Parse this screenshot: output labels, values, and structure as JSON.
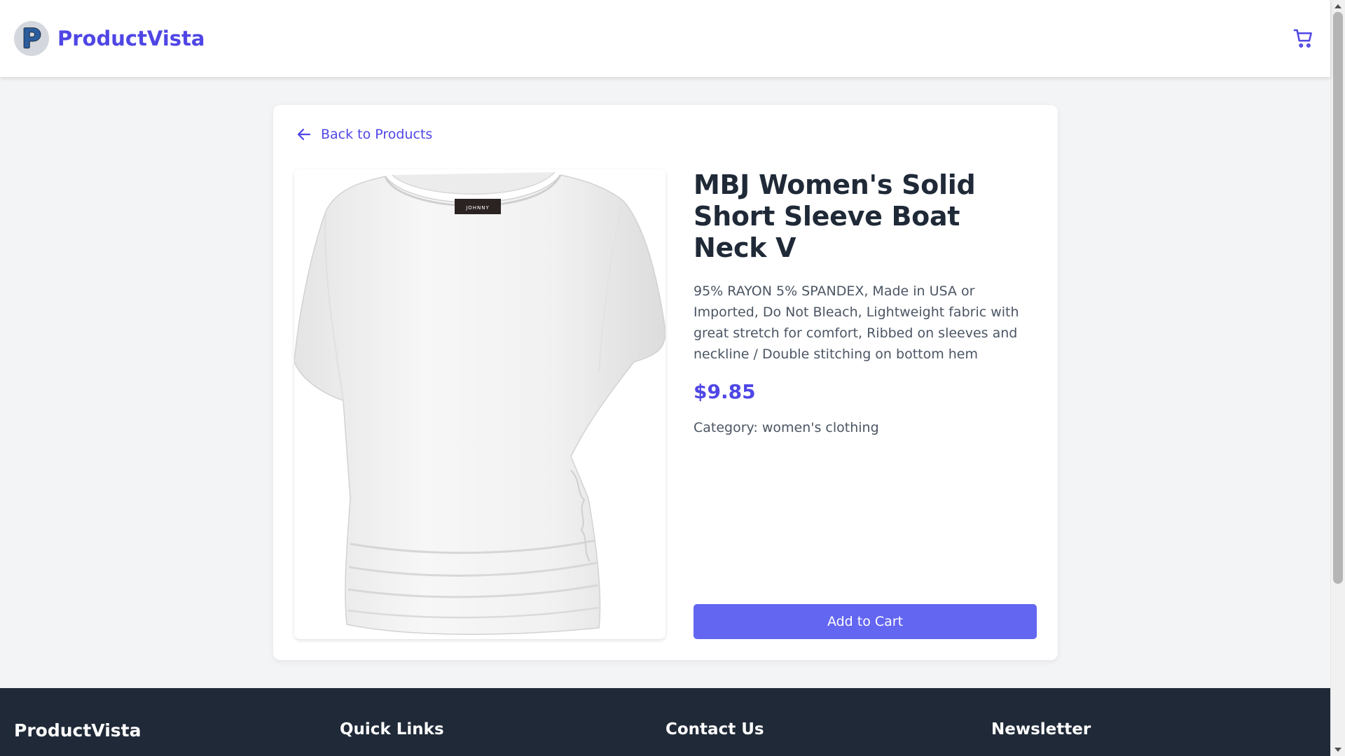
{
  "header": {
    "logo_letter": "P",
    "brand": "ProductVista",
    "cart_icon": "shopping-cart-icon"
  },
  "product": {
    "back_label": "Back to Products",
    "back_icon": "arrow-left-icon",
    "title": "MBJ Women's Solid Short Sleeve Boat Neck V",
    "description": "95% RAYON 5% SPANDEX, Made in USA or Imported, Do Not Bleach, Lightweight fabric with great stretch for comfort, Ribbed on sleeves and neckline / Double stitching on bottom hem",
    "price": "$9.85",
    "category": "Category: women's clothing",
    "add_to_cart_label": "Add to Cart",
    "shirt_tag_text": "JOHNNY"
  },
  "footer": {
    "brand": "ProductVista",
    "quick_links_title": "Quick Links",
    "contact_title": "Contact Us",
    "newsletter_title": "Newsletter"
  },
  "colors": {
    "accent": "#4f46e5",
    "button": "#6366f1",
    "footer_bg": "#1f2937",
    "page_bg": "#f3f4f6"
  }
}
